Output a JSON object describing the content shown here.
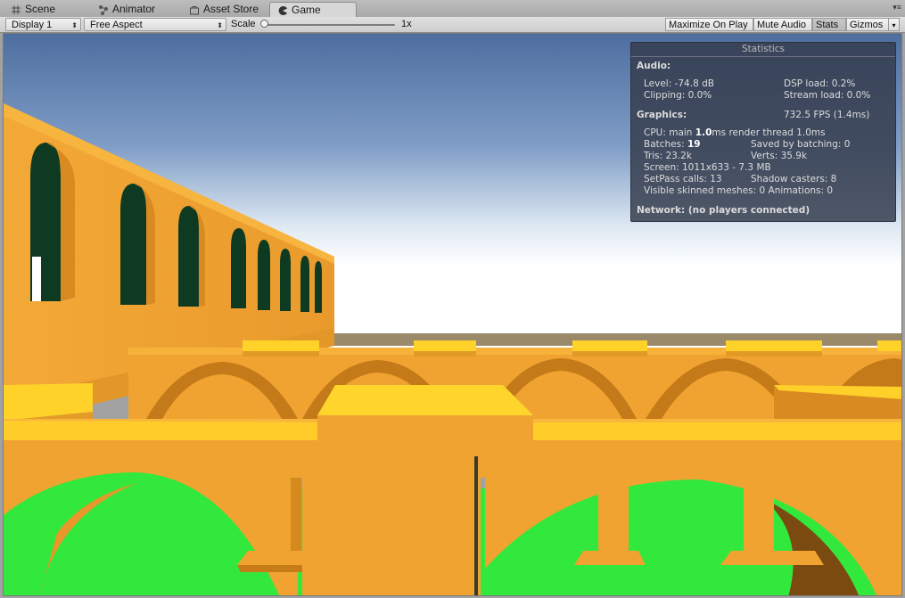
{
  "tabs": [
    {
      "label": "Scene",
      "icon": "grid-icon",
      "active": false
    },
    {
      "label": "Animator",
      "icon": "animator-icon",
      "active": false
    },
    {
      "label": "Asset Store",
      "icon": "shopping-bag-icon",
      "active": false
    },
    {
      "label": "Game",
      "icon": "pacman-icon",
      "active": true
    }
  ],
  "toolbar": {
    "display": "Display 1",
    "aspect": "Free Aspect",
    "scale_label": "Scale",
    "scale_value": "1x",
    "scale_fraction": 0.0,
    "maximize_on_play": "Maximize On Play",
    "mute_audio": "Mute Audio",
    "stats": "Stats",
    "gizmos": "Gizmos"
  },
  "statistics": {
    "title": "Statistics",
    "audio_header": "Audio:",
    "level": "Level: -74.8 dB",
    "dsp_load": "DSP load: 0.2%",
    "clipping": "Clipping: 0.0%",
    "stream_load": "Stream load: 0.0%",
    "graphics_header": "Graphics:",
    "fps": "732.5 FPS (1.4ms)",
    "cpu_prefix": "CPU: main ",
    "cpu_main": "1.0",
    "cpu_suffix": "ms  render thread 1.0ms",
    "batches_prefix": "Batches: ",
    "batches": "19",
    "saved_by_batching": "Saved by batching: 0",
    "tris": "Tris: 23.2k",
    "verts": "Verts: 35.9k",
    "screen": "Screen: 1011x633 - 7.3 MB",
    "setpass": "SetPass calls: 13",
    "shadow_casters": "Shadow casters: 8",
    "visible_skinned": "Visible skinned meshes: 0  Animations: 0",
    "network": "Network: (no players connected)"
  },
  "colors": {
    "sky_top": "#5577a8",
    "sky_horizon": "#e9eef2",
    "wall": "#f0a330",
    "wall_dark": "#c27a18",
    "top_light": "#ffd52c",
    "grass": "#33e83c",
    "window_dark": "#103a22"
  }
}
